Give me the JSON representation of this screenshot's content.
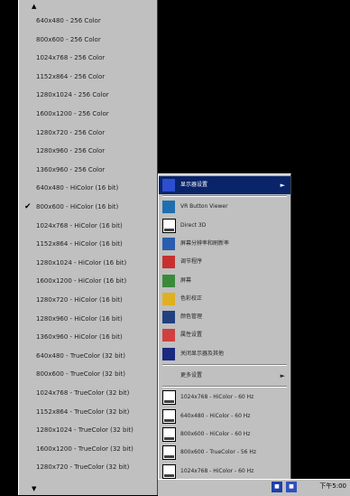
{
  "resolution_menu": {
    "scroll_up": "▲",
    "scroll_down": "▼",
    "checked_mark": "✔",
    "checked_index": 10,
    "items": [
      "640x480 - 256 Color",
      "800x600 - 256 Color",
      "1024x768 - 256 Color",
      "1152x864 - 256 Color",
      "1280x1024 - 256 Color",
      "1600x1200 - 256 Color",
      "1280x720 - 256 Color",
      "1280x960 - 256 Color",
      "1360x960 - 256 Color",
      "640x480 - HiColor (16 bit)",
      "800x600 - HiColor (16 bit)",
      "1024x768 - HiColor (16 bit)",
      "1152x864 - HiColor (16 bit)",
      "1280x1024 - HiColor (16 bit)",
      "1600x1200 - HiColor (16 bit)",
      "1280x720 - HiColor (16 bit)",
      "1280x960 - HiColor (16 bit)",
      "1360x960 - HiColor (16 bit)",
      "640x480 - TrueColor (32 bit)",
      "800x600 - TrueColor (32 bit)",
      "1024x768 - TrueColor (32 bit)",
      "1152x864 - TrueColor (32 bit)",
      "1280x1024 - TrueColor (32 bit)",
      "1600x1200 - TrueColor (32 bit)",
      "1280x720 - TrueColor (32 bit)"
    ]
  },
  "context_menu": {
    "submenu_arrow": "►",
    "items": [
      {
        "label": "显示器设置",
        "icon": "display-icon",
        "submenu": true,
        "active": true
      },
      {
        "label": "VR Button Viewer",
        "icon": "app-icon"
      },
      {
        "label": "Direct 3D",
        "icon": "monitor-icon"
      },
      {
        "label": "屏幕分辨率和刷新率",
        "icon": "settings-icon"
      },
      {
        "label": "调节程序",
        "icon": "adjust-icon"
      },
      {
        "label": "屏幕",
        "icon": "screen-icon"
      },
      {
        "label": "色彩校正",
        "icon": "color-icon"
      },
      {
        "label": "颜色管理",
        "icon": "color-manage-icon"
      },
      {
        "label": "属性设置",
        "icon": "properties-icon"
      },
      {
        "label": "关闭显示器及其他",
        "icon": "power-icon"
      },
      {
        "label": "更多设置",
        "icon": "",
        "submenu": true
      },
      {
        "label": "1024x768 - HiColor - 60 Hz",
        "icon": "monitor-icon"
      },
      {
        "label": "640x480 - HiColor - 60 Hz",
        "icon": "monitor-icon"
      },
      {
        "label": "800x600 - HiColor - 60 Hz",
        "icon": "monitor-icon"
      },
      {
        "label": "800x600 - TrueColor - 56 Hz",
        "icon": "monitor-icon"
      },
      {
        "label": "1024x768 - HiColor - 60 Hz",
        "icon": "monitor-icon"
      }
    ]
  },
  "tray": {
    "clock": "下午5:00"
  }
}
